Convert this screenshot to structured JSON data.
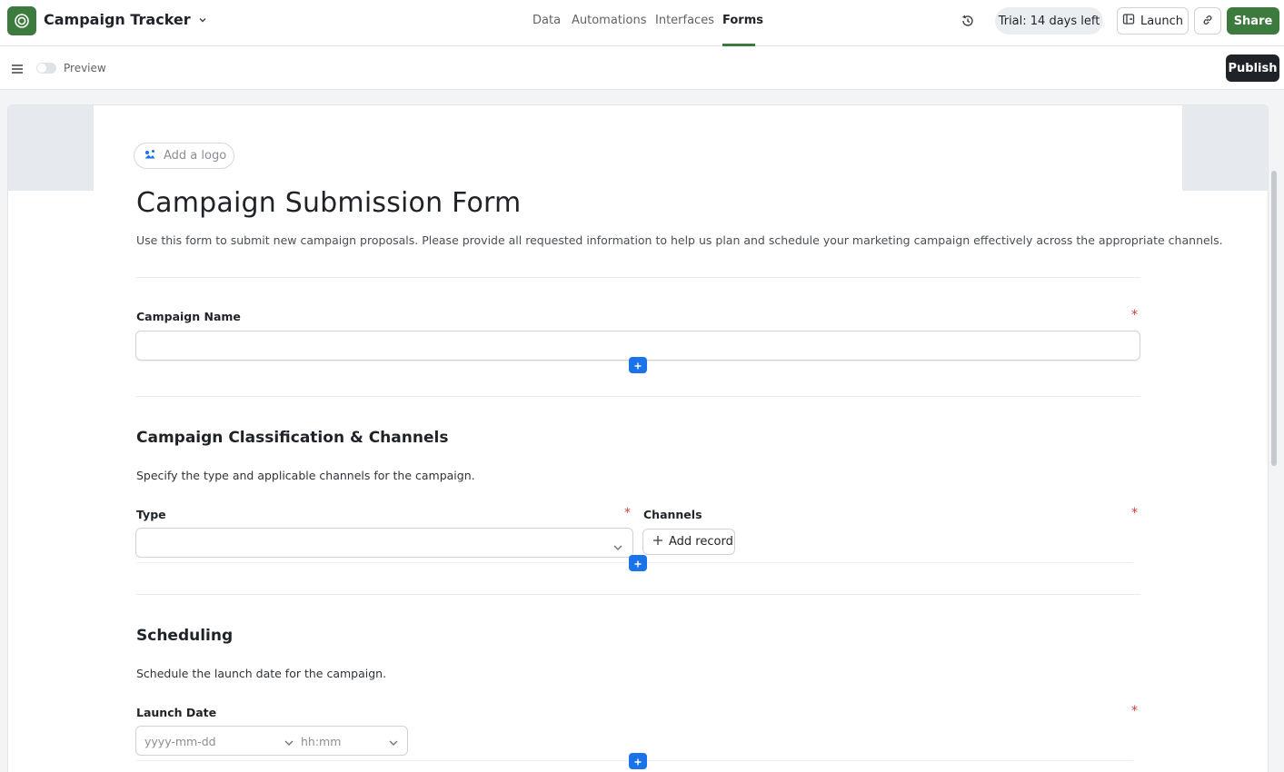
{
  "app": {
    "title": "Campaign Tracker",
    "accent_color": "#3d7a3d",
    "logo_icon": "app-logo-icon"
  },
  "nav": {
    "tabs": [
      {
        "label": "Data"
      },
      {
        "label": "Automations"
      },
      {
        "label": "Interfaces"
      },
      {
        "label": "Forms",
        "active": true
      }
    ]
  },
  "header_actions": {
    "trial_label": "Trial: 14 days left",
    "launch_label": "Launch",
    "share_label": "Share"
  },
  "toolbar": {
    "preview_label": "Preview",
    "preview_enabled": false,
    "publish_label": "Publish"
  },
  "form": {
    "add_logo_label": "Add a logo",
    "title": "Campaign Submission Form",
    "description": "Use this form to submit new campaign proposals. Please provide all requested information to help us plan and schedule your marketing campaign effectively across the appropriate channels.",
    "required_marker": "*",
    "fields": {
      "campaign_name": {
        "label": "Campaign Name",
        "value": "",
        "required": true
      }
    },
    "sections": [
      {
        "title": "Campaign Classification & Channels",
        "description": "Specify the type and applicable channels for the campaign.",
        "fields": {
          "type": {
            "label": "Type",
            "value": "",
            "required": true
          },
          "channels": {
            "label": "Channels",
            "button_label": "Add record",
            "required": true
          }
        }
      },
      {
        "title": "Scheduling",
        "description": "Schedule the launch date for the campaign.",
        "fields": {
          "launch_date": {
            "label": "Launch Date",
            "date_placeholder": "yyyy-mm-dd",
            "time_placeholder": "hh:mm",
            "required": true
          }
        }
      }
    ]
  }
}
